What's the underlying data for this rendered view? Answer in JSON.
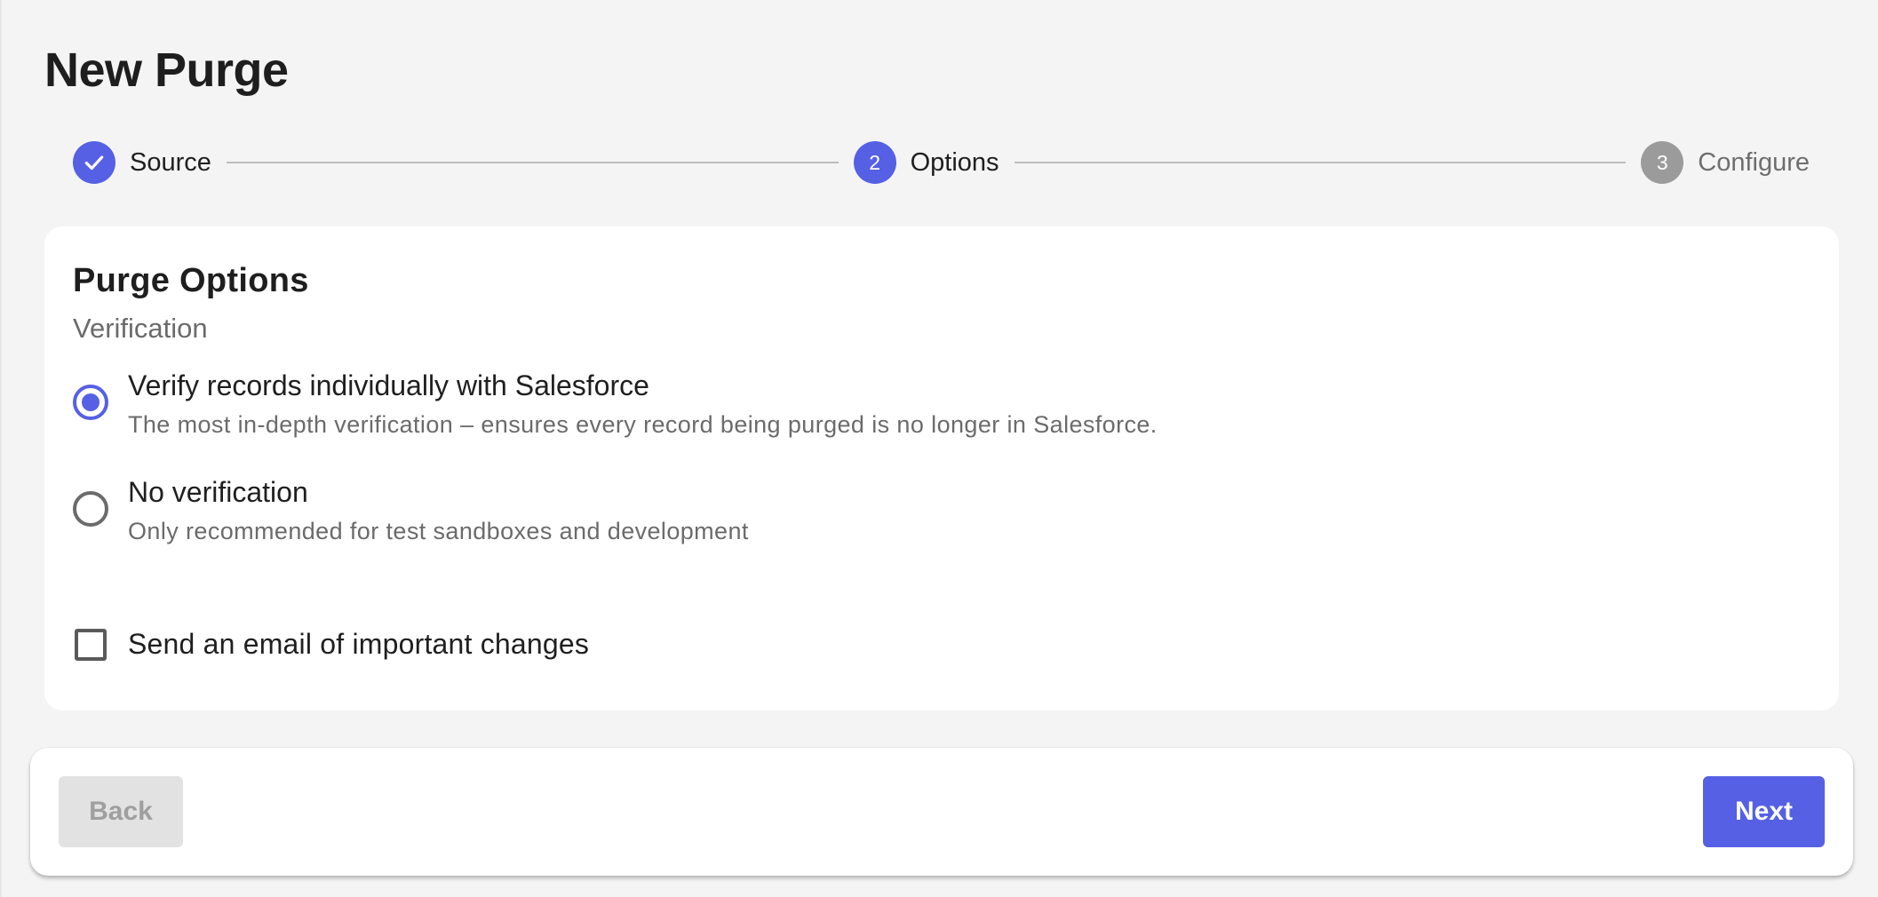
{
  "page": {
    "title": "New Purge"
  },
  "stepper": {
    "steps": [
      {
        "number": "1",
        "label": "Source",
        "status": "completed"
      },
      {
        "number": "2",
        "label": "Options",
        "status": "active"
      },
      {
        "number": "3",
        "label": "Configure",
        "status": "pending"
      }
    ]
  },
  "card": {
    "title": "Purge Options",
    "section_label": "Verification",
    "options": [
      {
        "title": "Verify records individually with Salesforce",
        "description": "The most in-depth verification – ensures every record being purged is no longer in Salesforce.",
        "selected": true
      },
      {
        "title": "No verification",
        "description": "Only recommended for test sandboxes and development",
        "selected": false
      }
    ],
    "email_checkbox": {
      "label": "Send an email of important changes",
      "checked": false
    }
  },
  "footer": {
    "back_label": "Back",
    "next_label": "Next"
  },
  "colors": {
    "accent": "#5560e4",
    "pending": "#9b9b9b",
    "background": "#f4f4f4"
  }
}
